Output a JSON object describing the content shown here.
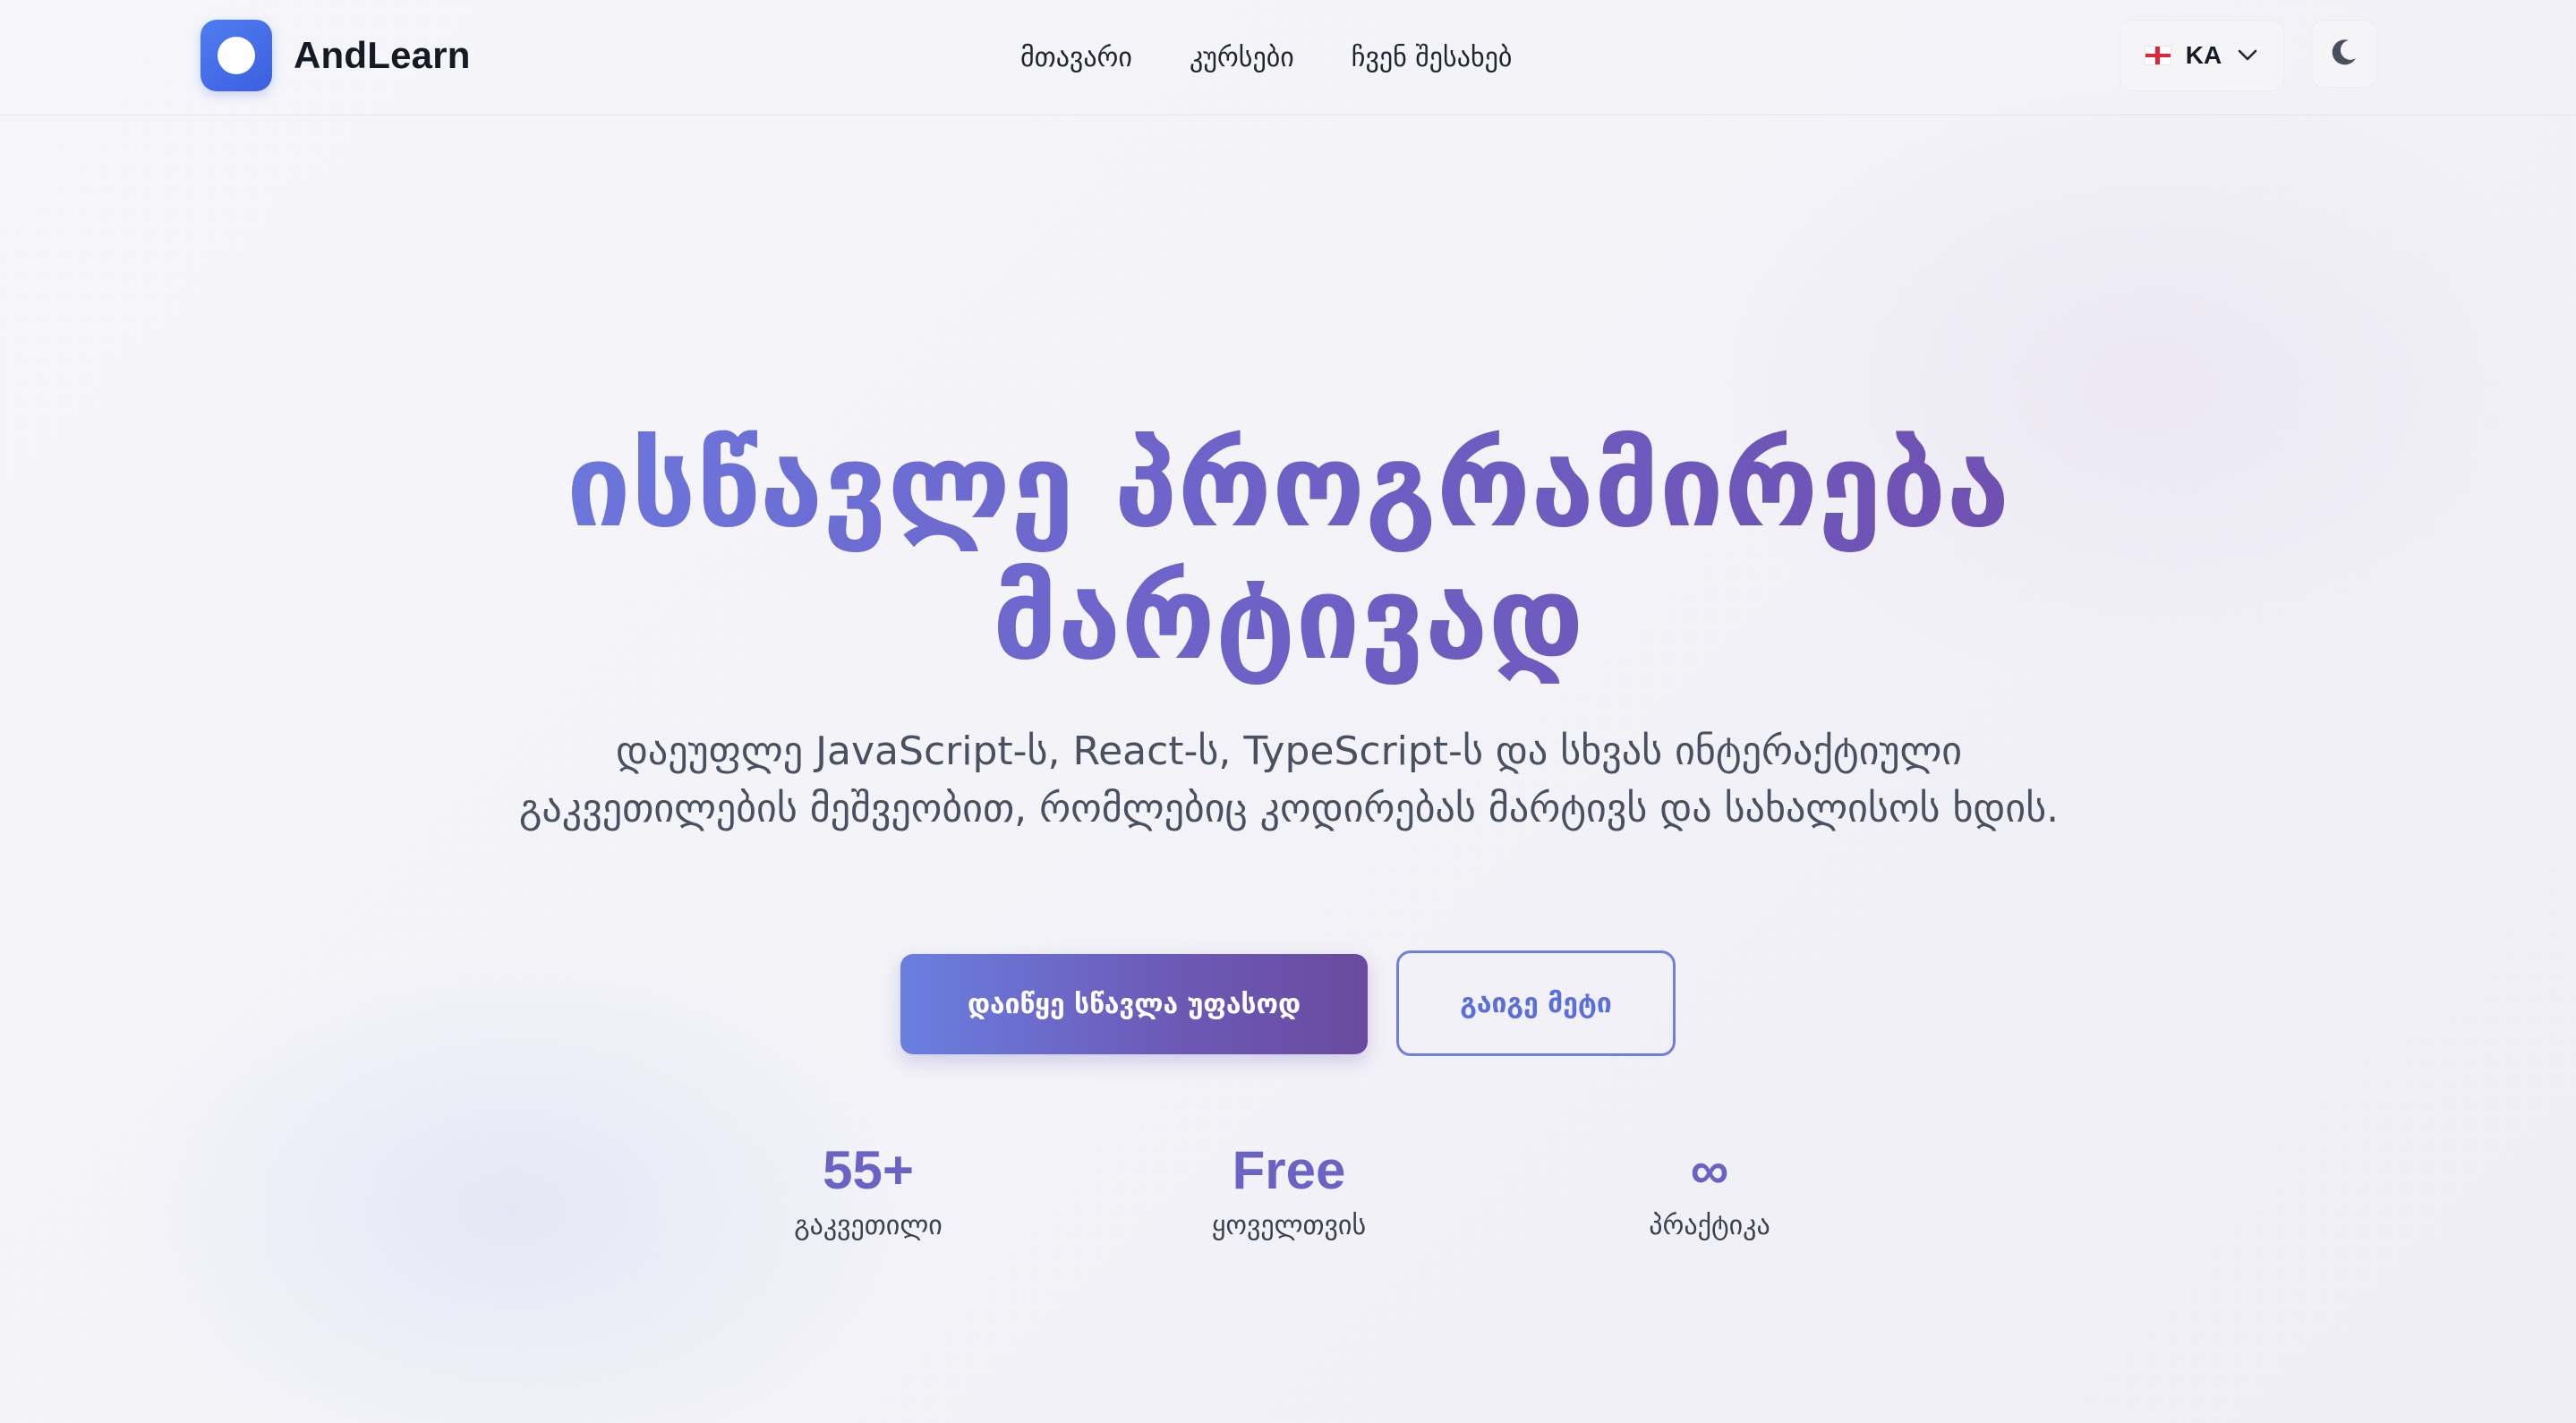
{
  "header": {
    "brand_name": "AndLearn",
    "nav": [
      {
        "label": "მთავარი"
      },
      {
        "label": "კურსები"
      },
      {
        "label": "ჩვენ შესახებ"
      }
    ],
    "language": {
      "code": "KA",
      "flag_icon": "georgia-flag-icon"
    },
    "theme_toggle_icon": "moon-icon"
  },
  "hero": {
    "title_line1": "ისწავლე პროგრამირება",
    "title_line2": "მარტივად",
    "subtitle": "დაეუფლე JavaScript-ს, React-ს, TypeScript-ს და სხვას ინტერაქტიული გაკვეთილების მეშვეობით, რომლებიც კოდირებას მარტივს და სახალისოს ხდის.",
    "primary_cta": "დაიწყე სწავლა უფასოდ",
    "secondary_cta": "გაიგე მეტი"
  },
  "stats": [
    {
      "value": "55+",
      "label": "გაკვეთილი"
    },
    {
      "value": "Free",
      "label": "ყოველთვის"
    },
    {
      "value": "∞",
      "label": "პრაქტიკა"
    }
  ],
  "colors": {
    "accent_blue": "#4f7df0",
    "accent_purple": "#6a4a9f",
    "stat_color": "#6a63c4"
  }
}
